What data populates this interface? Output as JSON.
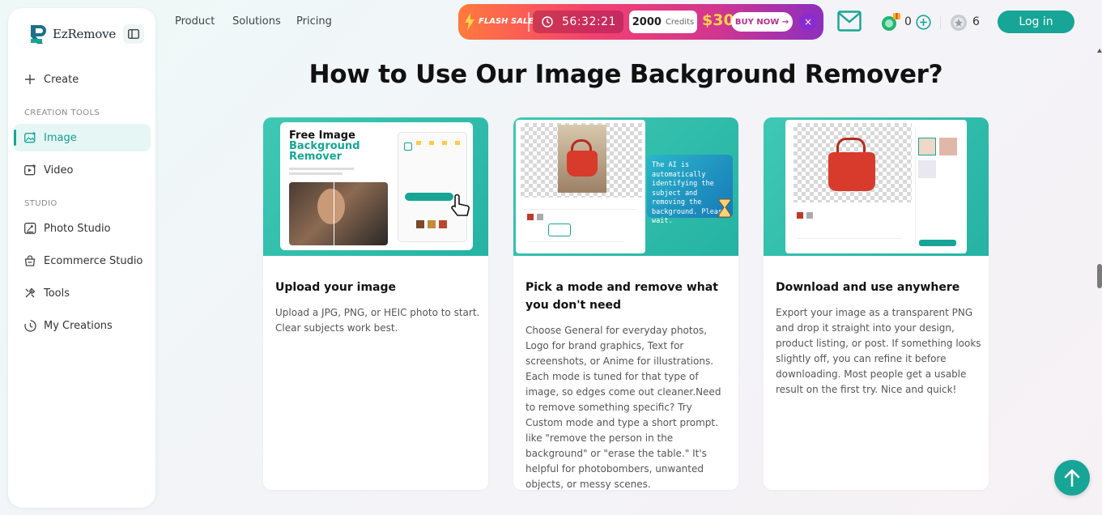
{
  "brand": {
    "name": "EzRemove"
  },
  "sidebar": {
    "create_label": "Create",
    "section_creation_tools": "CREATION TOOLS",
    "image_label": "Image",
    "video_label": "Video",
    "section_studio": "STUDIO",
    "photo_studio_label": "Photo Studio",
    "ecommerce_studio_label": "Ecommerce Studio",
    "tools_label": "Tools",
    "my_creations_label": "My Creations"
  },
  "topnav": {
    "product": "Product",
    "solutions": "Solutions",
    "pricing": "Pricing"
  },
  "flash_sale": {
    "label": "FLASH SALE",
    "timer": "56:32:21",
    "credits_amount": "2000",
    "credits_word": "Credits",
    "price": "$30",
    "buy_now": "BUY NOW →",
    "close": "×"
  },
  "header": {
    "points": "0",
    "coins": "6",
    "login_label": "Log in"
  },
  "main": {
    "heading": "How to Use Our Image Background Remover?",
    "cards": [
      {
        "title": "Upload your image",
        "body": "Upload a JPG, PNG, or HEIC photo to start. Clear subjects work best.",
        "mock_title_1": "Free Image",
        "mock_title_2": "Background",
        "mock_title_3": "Remover"
      },
      {
        "title": "Pick a mode and remove what you don't need",
        "body": "Choose General for everyday photos, Logo for brand graphics, Text for screenshots, or Anime for illustrations. Each mode is tuned for that type of image, so edges come out cleaner.Need to remove something specific? Try Custom mode and type a short prompt. like \"remove the person in the background\" or \"erase the table.\" It's helpful for photobombers, unwanted objects, or messy scenes.",
        "ai_message": "The AI is automatically identifying the subject and removing the background. Please wait."
      },
      {
        "title": "Download and use anywhere",
        "body": "Export your image as a transparent PNG and drop it straight into your design, product listing, or post. If something looks slightly off, you can refine it before downloading. Most people get a usable result on the first try. Nice and quick!"
      }
    ]
  },
  "colors": {
    "accent": "#16a596",
    "flash_start": "#ff7a3d",
    "flash_end": "#8c2fbf",
    "price": "#ffd24a"
  }
}
